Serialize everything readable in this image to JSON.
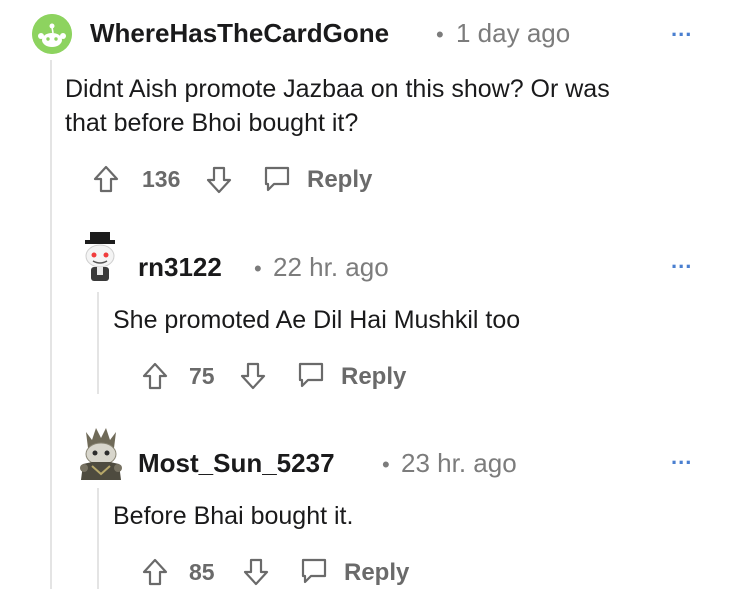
{
  "comments": [
    {
      "username": "WhereHasTheCardGone",
      "separator": "•",
      "time": "1 day ago",
      "body": "Didnt Aish promote Jazbaa on this show? Or was that before Bhoi bought it?",
      "votes": "136",
      "reply_label": "Reply",
      "more_label": "..."
    },
    {
      "username": "rn3122",
      "separator": "•",
      "time": "22 hr. ago",
      "body": "She promoted Ae Dil Hai Mushkil too",
      "votes": "75",
      "reply_label": "Reply",
      "more_label": "..."
    },
    {
      "username": "Most_Sun_5237",
      "separator": "•",
      "time": "23 hr. ago",
      "body": "Before Bhai bought it.",
      "votes": "85",
      "reply_label": "Reply",
      "more_label": "..."
    }
  ],
  "colors": {
    "avatar_green": "#8dd35f",
    "more_blue": "#4a7fd0",
    "meta_gray": "#7c7c7c",
    "thread_line": "#e4e4e4"
  },
  "icons": [
    "snoo-avatar-icon",
    "upvote-icon",
    "downvote-icon",
    "reply-bubble-icon",
    "more-options-icon"
  ]
}
